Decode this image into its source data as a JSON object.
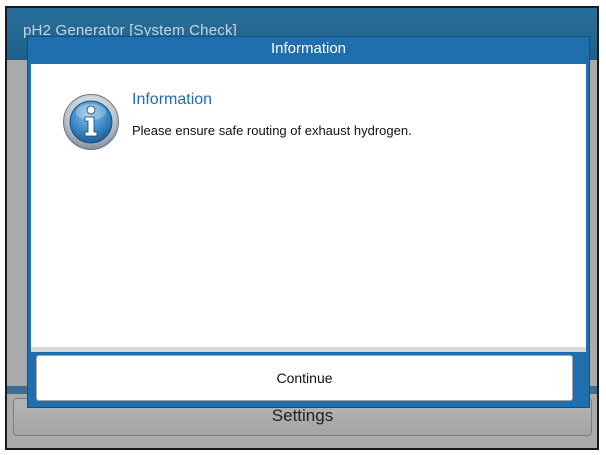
{
  "app": {
    "title": "pH2 Generator  [System Check]"
  },
  "background": {
    "settings_label": "Settings"
  },
  "dialog": {
    "title": "Information",
    "heading": "Information",
    "message": "Please ensure safe routing of exhaust hydrogen.",
    "continue_label": "Continue",
    "icon": "info-icon"
  },
  "colors": {
    "accent": "#1f6fae",
    "titlebar": "#1d5f8a",
    "overlay": "#a9aaac"
  }
}
